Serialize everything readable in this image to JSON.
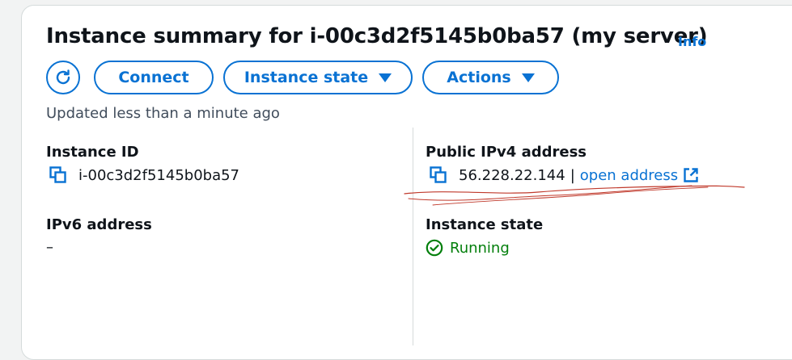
{
  "header": {
    "title": "Instance summary for i-00c3d2f5145b0ba57 (my server)",
    "info_label": "Info"
  },
  "toolbar": {
    "refresh_icon": "refresh-icon",
    "connect_label": "Connect",
    "instance_state_label": "Instance state",
    "actions_label": "Actions"
  },
  "status": {
    "updated_text": "Updated less than a minute ago"
  },
  "details": {
    "instance_id_label": "Instance ID",
    "instance_id_value": "i-00c3d2f5145b0ba57",
    "ipv6_label": "IPv6 address",
    "ipv6_value": "–",
    "public_ipv4_label": "Public IPv4 address",
    "public_ipv4_value": "56.228.22.144",
    "separator": "|",
    "open_address_label": "open address",
    "instance_state_label": "Instance state",
    "instance_state_value": "Running"
  },
  "colors": {
    "accent": "#0972d3",
    "success": "#037f0c",
    "annotation": "#c0392b"
  }
}
